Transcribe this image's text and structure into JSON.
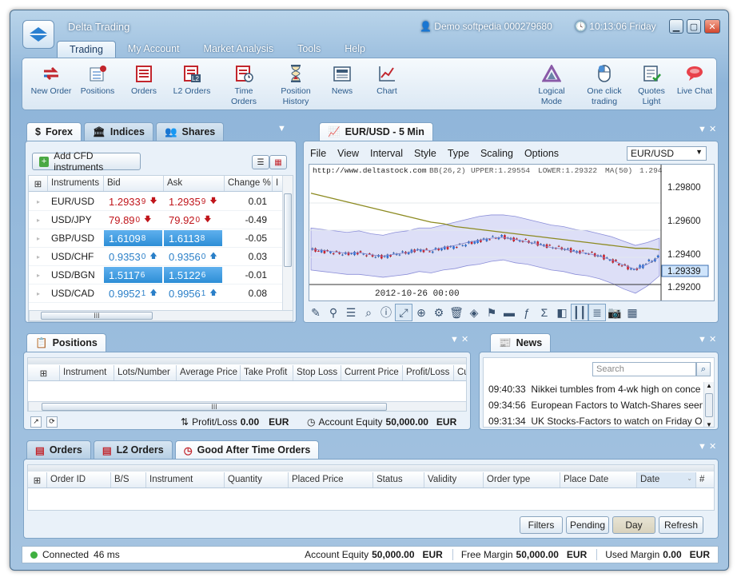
{
  "window": {
    "title": "Delta Trading",
    "user": "Demo softpedia 000279680",
    "clock": "10:13:06 Friday"
  },
  "menu": [
    "Trading",
    "My Account",
    "Market Analysis",
    "Tools",
    "Help"
  ],
  "ribbon": {
    "left": [
      {
        "label": "New Order",
        "icon": "new-order-icon"
      },
      {
        "label": "Positions",
        "icon": "positions-icon"
      },
      {
        "label": "Orders",
        "icon": "orders-icon"
      },
      {
        "label": "L2 Orders",
        "icon": "l2-orders-icon"
      },
      {
        "label": "Time Orders",
        "icon": "time-orders-icon"
      },
      {
        "label": "Position History",
        "icon": "hourglass-icon"
      },
      {
        "label": "News",
        "icon": "news-icon"
      },
      {
        "label": "Chart",
        "icon": "chart-icon"
      }
    ],
    "right": [
      {
        "label": "Logical Mode",
        "icon": "logical-mode-icon"
      },
      {
        "label": "One click trading",
        "icon": "mouse-icon"
      },
      {
        "label": "Quotes Light",
        "icon": "quotes-light-icon"
      },
      {
        "label": "Live Chat",
        "icon": "chat-icon"
      }
    ]
  },
  "market": {
    "tabs": [
      "Forex",
      "Indices",
      "Shares"
    ],
    "add_button": "Add CFD instruments",
    "columns": [
      "Instruments",
      "Bid",
      "Ask",
      "Change %"
    ],
    "rows": [
      {
        "instrument": "EUR/USD",
        "bid_main": "1.2933",
        "bid_pip": "9",
        "ask_main": "1.2935",
        "ask_pip": "9",
        "change": "0.01",
        "dir": "down",
        "style": "plain"
      },
      {
        "instrument": "USD/JPY",
        "bid_main": "79.89",
        "bid_pip": "0",
        "ask_main": "79.92",
        "ask_pip": "0",
        "change": "-0.49",
        "dir": "down",
        "style": "plain"
      },
      {
        "instrument": "GBP/USD",
        "bid_main": "1.6109",
        "bid_pip": "8",
        "ask_main": "1.6113",
        "ask_pip": "8",
        "change": "-0.05",
        "dir": "up",
        "style": "blue"
      },
      {
        "instrument": "USD/CHF",
        "bid_main": "0.9353",
        "bid_pip": "0",
        "ask_main": "0.9356",
        "ask_pip": "0",
        "change": "0.03",
        "dir": "up",
        "style": "plain"
      },
      {
        "instrument": "USD/BGN",
        "bid_main": "1.5117",
        "bid_pip": "6",
        "ask_main": "1.5122",
        "ask_pip": "6",
        "change": "-0.01",
        "dir": "up",
        "style": "blue"
      },
      {
        "instrument": "USD/CAD",
        "bid_main": "0.9952",
        "bid_pip": "1",
        "ask_main": "0.9956",
        "ask_pip": "1",
        "change": "0.08",
        "dir": "up",
        "style": "plain"
      }
    ]
  },
  "chart": {
    "tab": "EUR/USD - 5 Min",
    "menu": [
      "File",
      "View",
      "Interval",
      "Style",
      "Type",
      "Scaling",
      "Options"
    ],
    "symbol": "EUR/USD",
    "url": "http://www.deltastock.com",
    "indicators": [
      "BB(26,2)",
      "UPPER:1.29554",
      "LOWER:1.29322",
      "MA(50)",
      "1.294"
    ],
    "price_labels": [
      "1.29800",
      "1.29600",
      "1.29400",
      "1.29200"
    ],
    "current_price": "1.29339",
    "date_label": "2012-10-26 00:00"
  },
  "chart_data": {
    "type": "line",
    "title": "EUR/USD - 5 Min",
    "xlabel": "",
    "ylabel": "",
    "ylim": [
      1.2915,
      1.299
    ],
    "series": [
      {
        "values": [
          1.2939,
          1.2938,
          1.2937,
          1.2936,
          1.2937,
          1.2935,
          1.2934,
          1.2936,
          1.2937,
          1.2939,
          1.2938,
          1.294,
          1.2941,
          1.2943,
          1.2945,
          1.2947,
          1.2948,
          1.2946,
          1.2945,
          1.2943,
          1.2941,
          1.294,
          1.2938,
          1.2937,
          1.2935,
          1.2932,
          1.2928,
          1.2925,
          1.293,
          1.2934
        ]
      },
      {
        "values": [
          1.2978,
          1.2976,
          1.2974,
          1.2972,
          1.297,
          1.2968,
          1.2966,
          1.2964,
          1.2962,
          1.296,
          1.2958,
          1.2957,
          1.2955,
          1.2954,
          1.2953,
          1.2952,
          1.2951,
          1.295,
          1.2949,
          1.2948,
          1.2947,
          1.2946,
          1.2945,
          1.2944,
          1.2943,
          1.2942,
          1.2941,
          1.294,
          1.294,
          1.2939
        ]
      },
      {
        "values": [
          1.2954,
          1.2953,
          1.2952,
          1.2951,
          1.2952,
          1.295,
          1.2949,
          1.2951,
          1.2952,
          1.2954,
          1.2954,
          1.2956,
          1.2958,
          1.296,
          1.2962,
          1.2963,
          1.2963,
          1.2962,
          1.296,
          1.2958,
          1.2956,
          1.2955,
          1.2953,
          1.2952,
          1.295,
          1.2948,
          1.2945,
          1.2942,
          1.2944,
          1.2947
        ]
      },
      {
        "values": [
          1.2925,
          1.2924,
          1.2923,
          1.2922,
          1.2922,
          1.2921,
          1.292,
          1.2921,
          1.2922,
          1.2924,
          1.2923,
          1.2925,
          1.2926,
          1.2928,
          1.2929,
          1.2931,
          1.2932,
          1.293,
          1.2929,
          1.2927,
          1.2925,
          1.2924,
          1.2922,
          1.2921,
          1.2919,
          1.2916,
          1.2912,
          1.2909,
          1.2914,
          1.2921
        ]
      }
    ]
  },
  "positions": {
    "tab": "Positions",
    "columns": [
      "Instrument",
      "Lots/Number",
      "Average Price",
      "Take Profit",
      "Stop Loss",
      "Current Price",
      "Profit/Loss",
      "Cu"
    ],
    "pl_label": "Profit/Loss",
    "pl_value": "0.00",
    "pl_cur": "EUR",
    "eq_label": "Account Equity",
    "eq_value": "50,000.00",
    "eq_cur": "EUR"
  },
  "news": {
    "tab": "News",
    "search_placeholder": "Search",
    "items": [
      {
        "time": "09:40:33",
        "text": "Nikkei tumbles from 4-wk high on conce"
      },
      {
        "time": "09:34:56",
        "text": "European Factors to Watch-Shares seen"
      },
      {
        "time": "09:31:34",
        "text": "UK Stocks-Factors to watch on Friday Oc"
      }
    ]
  },
  "orders": {
    "tabs": [
      "Orders",
      "L2 Orders",
      "Good After Time Orders"
    ],
    "columns": [
      "Order ID",
      "B/S",
      "Instrument",
      "Quantity",
      "Placed Price",
      "Status",
      "Validity",
      "Order type",
      "Place Date",
      "Date",
      "#"
    ],
    "buttons": [
      "Filters",
      "Pending",
      "Day",
      "Refresh"
    ]
  },
  "status": {
    "connected": "Connected",
    "latency": "46 ms",
    "equity_label": "Account Equity",
    "equity_value": "50,000.00",
    "equity_cur": "EUR",
    "free_label": "Free Margin",
    "free_value": "50,000.00",
    "free_cur": "EUR",
    "used_label": "Used Margin",
    "used_value": "0.00",
    "used_cur": "EUR"
  },
  "colors": {
    "red": "#c0151b",
    "blue_cell": "#2d8ed6",
    "link": "#2b5b8c",
    "band": "#c7c9f2",
    "ma": "#8c8a20"
  }
}
